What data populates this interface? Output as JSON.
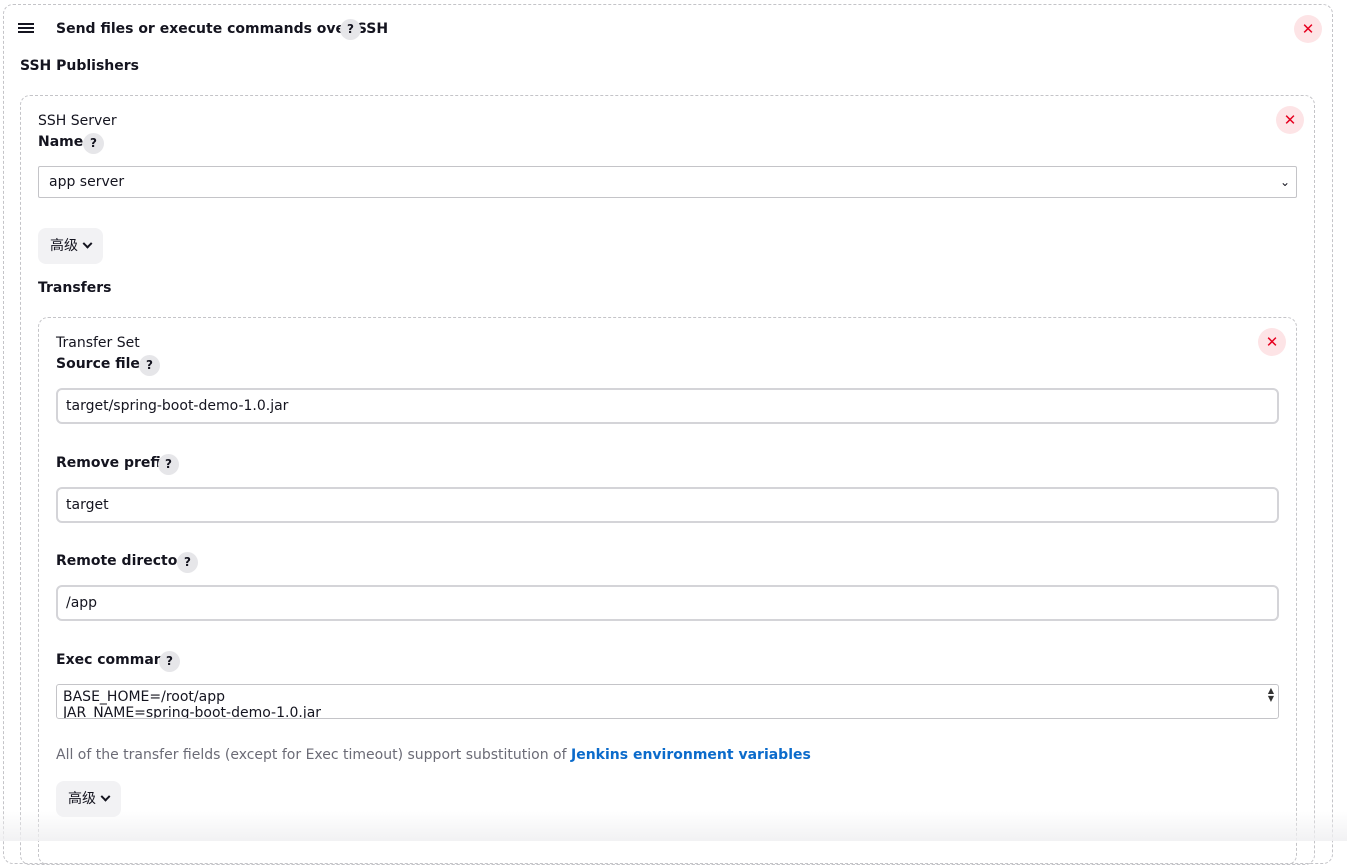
{
  "header": {
    "title": "Send files or execute commands over SSH",
    "help_glyph": "?",
    "close_glyph": "✕"
  },
  "publishers": {
    "label": "SSH Publishers"
  },
  "server": {
    "label": "SSH Server",
    "name_label": "Name",
    "name_value": "app server",
    "advanced_label": "高级"
  },
  "transfers": {
    "label": "Transfers",
    "set_label": "Transfer Set",
    "source_files_label": "Source files",
    "source_files_value": "target/spring-boot-demo-1.0.jar",
    "remove_prefix_label": "Remove prefix",
    "remove_prefix_value": "target",
    "remote_directory_label": "Remote directory",
    "remote_directory_value": "/app",
    "exec_command_label": "Exec command",
    "exec_command_line1": "BASE_HOME=/root/app",
    "exec_command_line2": "JAR_NAME=spring-boot-demo-1.0.jar",
    "note_text": "All of the transfer fields (except for Exec timeout) support substitution of ",
    "note_link": "Jenkins environment variables",
    "advanced_label": "高级"
  },
  "colors": {
    "accent_link": "#0b6bcb",
    "danger": "#e6001f",
    "danger_bg": "#fde4e6"
  }
}
